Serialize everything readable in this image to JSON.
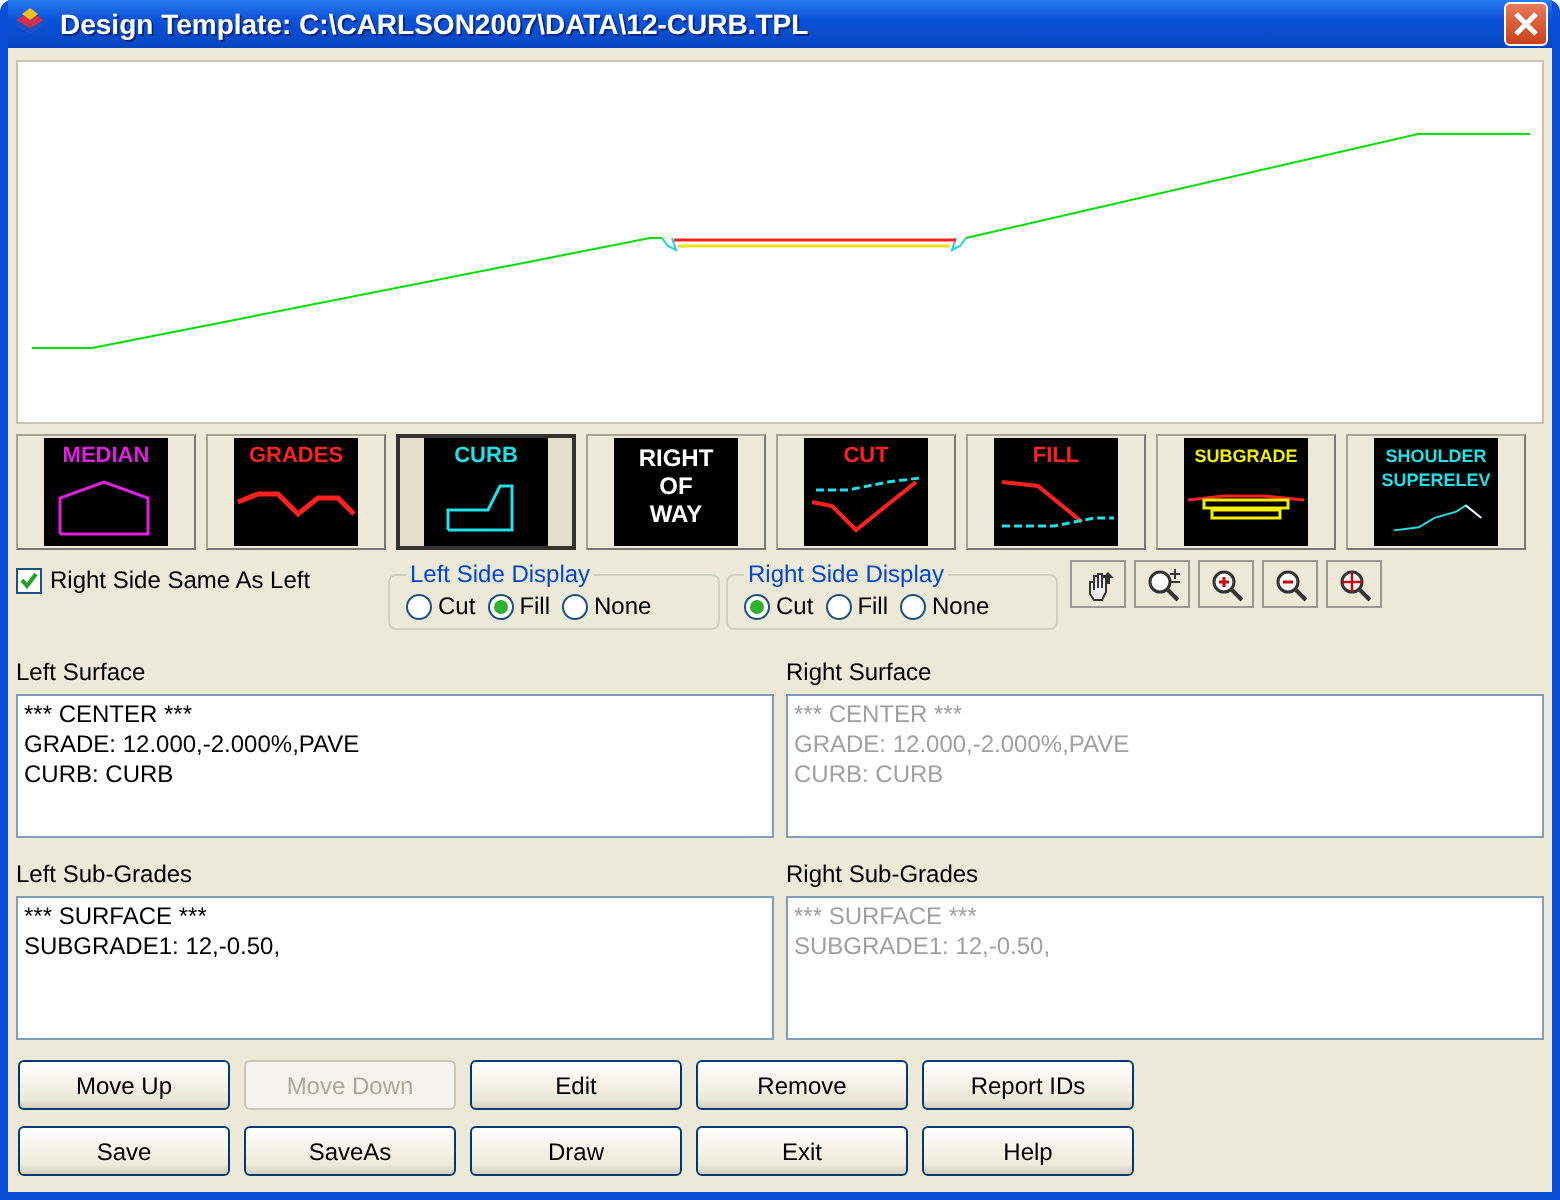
{
  "window": {
    "title": "Design Template: C:\\CARLSON2007\\DATA\\12-CURB.TPL"
  },
  "tools": [
    {
      "kind": "median",
      "lines": [
        "MEDIAN"
      ],
      "color": "#e020e0",
      "selected": false
    },
    {
      "kind": "grades",
      "lines": [
        "GRADES"
      ],
      "color": "#ff2020",
      "selected": false
    },
    {
      "kind": "curb",
      "lines": [
        "CURB"
      ],
      "color": "#20e0e8",
      "selected": true
    },
    {
      "kind": "right_of_way",
      "lines": [
        "RIGHT",
        "OF",
        "WAY"
      ],
      "color": "#ffffff",
      "selected": false
    },
    {
      "kind": "cut",
      "lines": [
        "CUT"
      ],
      "color": "#ff2020",
      "selected": false
    },
    {
      "kind": "fill",
      "lines": [
        "FILL"
      ],
      "color": "#ff2020",
      "selected": false
    },
    {
      "kind": "subgrade",
      "lines": [
        "SUBGRADE"
      ],
      "color": "#f0f000",
      "selected": false
    },
    {
      "kind": "shoulder",
      "lines": [
        "SHOULDER",
        "SUPERELEV"
      ],
      "color": "#20e0e8",
      "selected": false
    }
  ],
  "same_as_left": {
    "label": "Right Side Same As Left",
    "checked": true
  },
  "display_groups": [
    {
      "title": "Left Side Display",
      "options": [
        {
          "label": "Cut",
          "selected": false
        },
        {
          "label": "Fill",
          "selected": true
        },
        {
          "label": "None",
          "selected": false
        }
      ]
    },
    {
      "title": "Right Side Display",
      "options": [
        {
          "label": "Cut",
          "selected": true
        },
        {
          "label": "Fill",
          "selected": false
        },
        {
          "label": "None",
          "selected": false
        }
      ]
    }
  ],
  "zoom_tools": [
    {
      "kind": "pan"
    },
    {
      "kind": "zoom"
    },
    {
      "kind": "zoom_in"
    },
    {
      "kind": "zoom_out"
    },
    {
      "kind": "zoom_extents"
    }
  ],
  "lists": [
    {
      "label": "Left Surface",
      "disabled": false,
      "items": [
        "*** CENTER ***",
        "GRADE: 12.000,-2.000%,PAVE",
        "CURB: CURB"
      ]
    },
    {
      "label": "Right Surface",
      "disabled": true,
      "items": [
        "*** CENTER ***",
        "GRADE: 12.000,-2.000%,PAVE",
        "CURB: CURB"
      ]
    },
    {
      "label": "Left Sub-Grades",
      "disabled": false,
      "items": [
        "*** SURFACE ***",
        "SUBGRADE1: 12,-0.50,"
      ]
    },
    {
      "label": "Right Sub-Grades",
      "disabled": true,
      "items": [
        "*** SURFACE ***",
        "SUBGRADE1: 12,-0.50,"
      ]
    }
  ],
  "buttons": [
    [
      {
        "label": "Move Up",
        "disabled": false
      },
      {
        "label": "Move Down",
        "disabled": true
      },
      {
        "label": "Edit",
        "disabled": false
      },
      {
        "label": "Remove",
        "disabled": false
      },
      {
        "label": "Report IDs",
        "disabled": false
      }
    ],
    [
      {
        "label": "Save",
        "disabled": false
      },
      {
        "label": "SaveAs",
        "disabled": false
      },
      {
        "label": "Draw",
        "disabled": false
      },
      {
        "label": "Exit",
        "disabled": false
      },
      {
        "label": "Help",
        "disabled": false
      }
    ]
  ]
}
